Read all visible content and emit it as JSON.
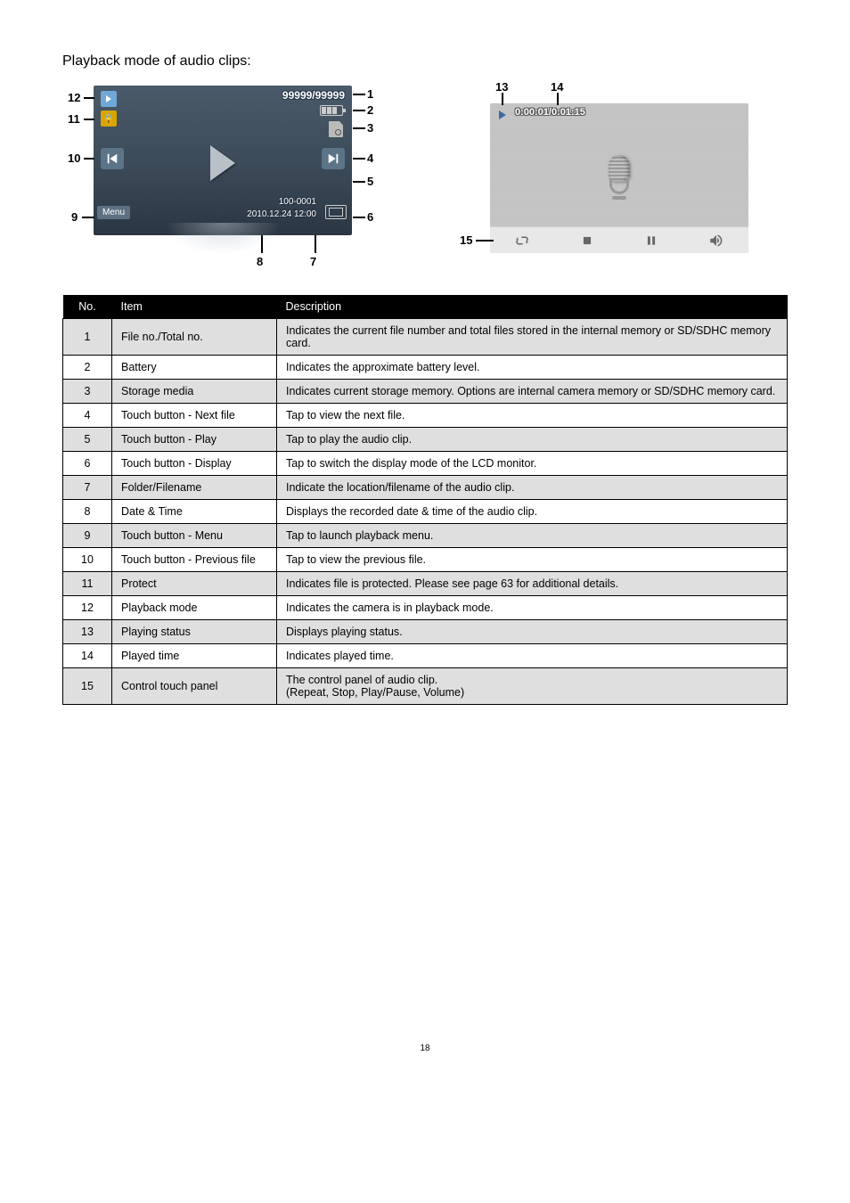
{
  "title": "Playback mode of audio clips:",
  "screen1": {
    "counter": "99999/99999",
    "menu": "Menu",
    "file": "100-0001",
    "date": "2010.12.24 12:00"
  },
  "screen2": {
    "time": "0:00:01/0:01:15"
  },
  "diagram_labels": {
    "l1": "1",
    "l2": "2",
    "l3": "3",
    "l4": "4",
    "l5": "5",
    "l6": "6",
    "l7": "7",
    "l8": "8",
    "l9": "9",
    "l10": "10",
    "l11": "11",
    "l12": "12",
    "l13": "13",
    "l14": "14",
    "l15": "15"
  },
  "table": {
    "headers": {
      "no": "No.",
      "item": "Item",
      "desc": "Description"
    },
    "rows": [
      {
        "no": "1",
        "item": "File no./Total no.",
        "desc": "Indicates the current file number and total files stored in the internal memory or SD/SDHC memory card."
      },
      {
        "no": "2",
        "item": "Battery",
        "desc": "Indicates the approximate battery level."
      },
      {
        "no": "3",
        "item": "Storage media",
        "desc": "Indicates current storage memory.  Options are internal camera memory or SD/SDHC memory card."
      },
      {
        "no": "4",
        "item": "Touch button - Next file",
        "desc": "Tap to view the next file."
      },
      {
        "no": "5",
        "item": "Touch button - Play",
        "desc": "Tap to play the audio clip."
      },
      {
        "no": "6",
        "item": "Touch button - Display",
        "desc": "Tap to switch the display mode of the LCD monitor."
      },
      {
        "no": "7",
        "item": "Folder/Filename",
        "desc": "Indicate the location/filename of the audio clip."
      },
      {
        "no": "8",
        "item": "Date & Time",
        "desc": "Displays the recorded date & time of the audio clip."
      },
      {
        "no": "9",
        "item": "Touch button - Menu",
        "desc": "Tap to launch playback menu."
      },
      {
        "no": "10",
        "item": "Touch button - Previous file",
        "desc": "Tap to view the previous file."
      },
      {
        "no": "11",
        "item": "Protect",
        "desc": "Indicates file is protected.  Please see page 63 for additional details."
      },
      {
        "no": "12",
        "item": "Playback mode",
        "desc": "Indicates the camera is in playback mode."
      },
      {
        "no": "13",
        "item": "Playing status",
        "desc": "Displays playing status."
      },
      {
        "no": "14",
        "item": "Played time",
        "desc": "Indicates played time."
      },
      {
        "no": "15",
        "item": "Control touch panel",
        "desc": "The control panel of audio clip.\n(Repeat, Stop, Play/Pause, Volume)"
      }
    ]
  },
  "page_number": "18"
}
